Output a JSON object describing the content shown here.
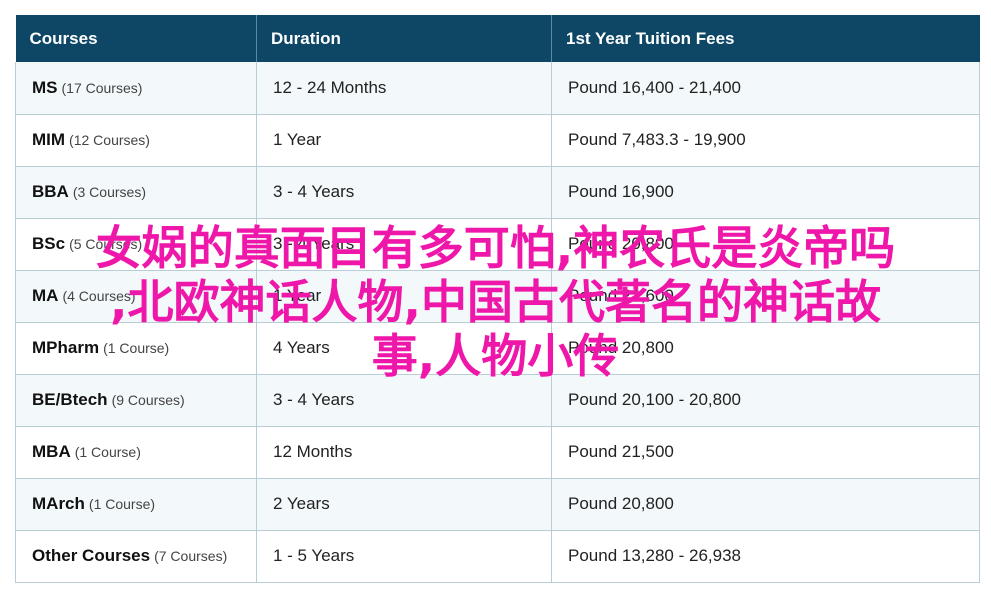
{
  "table": {
    "headers": [
      "Courses",
      "Duration",
      "1st Year Tuition Fees"
    ],
    "rows": [
      {
        "course": "MS",
        "count": "(17 Courses)",
        "duration": "12 - 24 Months",
        "fees": "Pound 16,400 - 21,400"
      },
      {
        "course": "MIM",
        "count": "(12 Courses)",
        "duration": "1 Year",
        "fees": "Pound 7,483.3 - 19,900"
      },
      {
        "course": "BBA",
        "count": "(3 Courses)",
        "duration": "3 - 4 Years",
        "fees": "Pound 16,900"
      },
      {
        "course": "BSc",
        "count": "(5 Courses)",
        "duration": "3 - 4 Years",
        "fees": "Pound 20,800"
      },
      {
        "course": "MA",
        "count": "(4 Courses)",
        "duration": "1 Year",
        "fees": "Pound 21,600"
      },
      {
        "course": "MPharm",
        "count": "(1 Course)",
        "duration": "4 Years",
        "fees": "Pound 20,800"
      },
      {
        "course": "BE/Btech",
        "count": "(9 Courses)",
        "duration": "3 - 4 Years",
        "fees": "Pound 20,100 - 20,800"
      },
      {
        "course": "MBA",
        "count": "(1 Course)",
        "duration": "12 Months",
        "fees": "Pound 21,500"
      },
      {
        "course": "MArch",
        "count": "(1 Course)",
        "duration": "2 Years",
        "fees": "Pound 20,800"
      },
      {
        "course": "Other Courses",
        "count": "(7 Courses)",
        "duration": "1 - 5 Years",
        "fees": "Pound 13,280 - 26,938"
      }
    ]
  },
  "overlay": {
    "line1": "女娲的真面目有多可怕,神农氏是炎帝吗",
    "line2": ",北欧神话人物,中国古代著名的神话故",
    "line3": "事,人物小传",
    "color": "#ee17a9"
  },
  "colors": {
    "header_bg": "#0d4765",
    "stripe": "#f3f8fb",
    "border": "#b9cdd9"
  }
}
